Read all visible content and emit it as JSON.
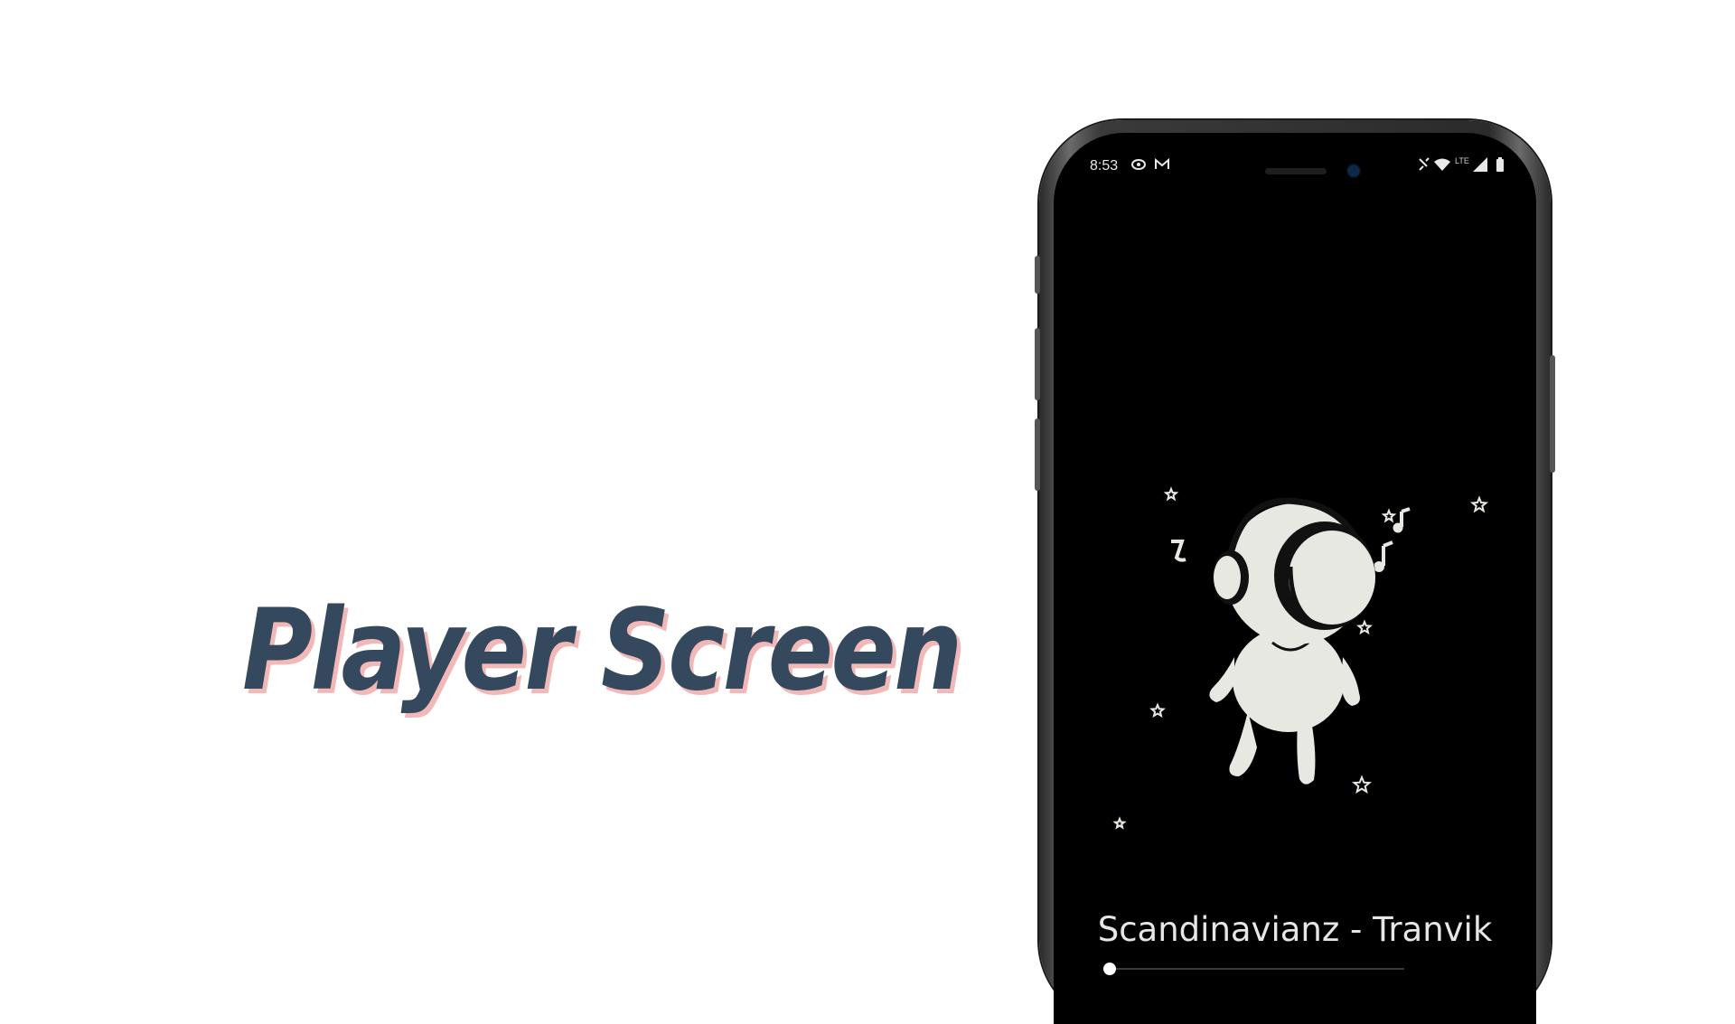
{
  "headline": "Player Screen",
  "status_bar": {
    "time": "8:53",
    "network_label": "LTE",
    "icons": [
      "sync-icon",
      "gmail-icon",
      "vibrate-icon",
      "wifi-icon",
      "cell-signal-icon",
      "battery-icon"
    ]
  },
  "player": {
    "track_title": "Scandinavianz - Tranvik",
    "progress": 0.0,
    "artwork": "astronaut-with-headphones-illustration"
  },
  "colors": {
    "headline": "#35495e",
    "headline_shadow": "#f2b8b8",
    "screen_background": "#000000",
    "artwork_fill": "#e8e8e2"
  }
}
